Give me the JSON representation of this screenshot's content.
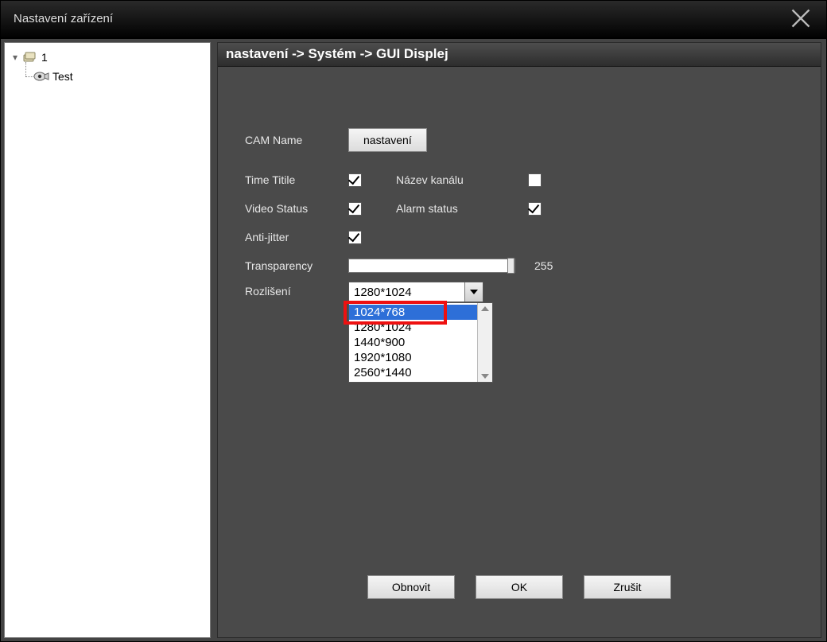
{
  "title": "Nastavení zařízení",
  "tree": {
    "root_label": "1",
    "child_label": "Test"
  },
  "breadcrumb": "nastavení -> Systém -> GUI Displej",
  "settings": {
    "cam_name_label": "CAM Name",
    "cam_name_button": "nastavení",
    "time_title_label": "Time Titile",
    "time_title_checked": true,
    "channel_name_label": "Název kanálu",
    "channel_name_checked": false,
    "video_status_label": "Video Status",
    "video_status_checked": true,
    "alarm_status_label": "Alarm status",
    "alarm_status_checked": true,
    "anti_jitter_label": "Anti-jitter",
    "anti_jitter_checked": true,
    "transparency_label": "Transparency",
    "transparency_value": "255",
    "resolution_label": "Rozlišení",
    "resolution_selected": "1280*1024",
    "resolution_options": [
      "1024*768",
      "1280*1024",
      "1440*900",
      "1920*1080",
      "2560*1440"
    ],
    "highlighted_option_index": 0
  },
  "buttons": {
    "refresh": "Obnovit",
    "ok": "OK",
    "cancel": "Zrušit"
  }
}
